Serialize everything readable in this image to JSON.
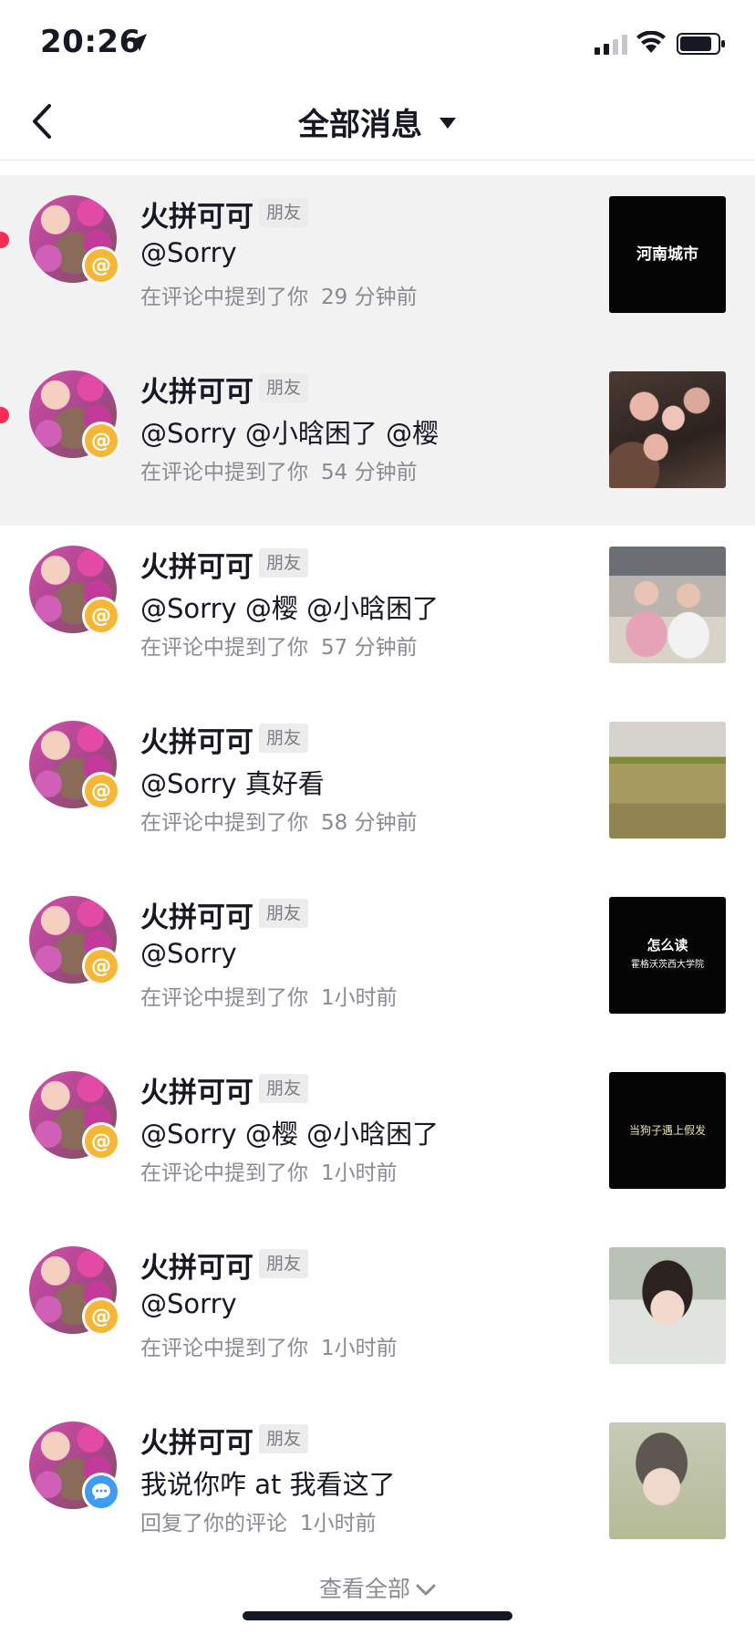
{
  "status": {
    "time": "20:26"
  },
  "nav": {
    "title": "全部消息"
  },
  "rows": [
    {
      "name": "火拼可可",
      "tag": "朋友",
      "message": "@Sorry",
      "action": "在评论中提到了你",
      "time": "29 分钟前",
      "thumb_text": "河南城市"
    },
    {
      "name": "火拼可可",
      "tag": "朋友",
      "message": "@Sorry @小晗困了 @樱",
      "action": "在评论中提到了你",
      "time": "54 分钟前"
    },
    {
      "name": "火拼可可",
      "tag": "朋友",
      "message": "@Sorry @樱 @小晗困了",
      "action": "在评论中提到了你",
      "time": "57 分钟前"
    },
    {
      "name": "火拼可可",
      "tag": "朋友",
      "message": "@Sorry 真好看",
      "action": "在评论中提到了你",
      "time": "58 分钟前"
    },
    {
      "name": "火拼可可",
      "tag": "朋友",
      "message": "@Sorry",
      "action": "在评论中提到了你",
      "time": "1小时前",
      "thumb_text": "怎么读",
      "thumb_subtext": "霍格沃茨西大学院"
    },
    {
      "name": "火拼可可",
      "tag": "朋友",
      "message": "@Sorry @樱 @小晗困了",
      "action": "在评论中提到了你",
      "time": "1小时前",
      "thumb_text": "当狗子遇上假发"
    },
    {
      "name": "火拼可可",
      "tag": "朋友",
      "message": "@Sorry",
      "action": "在评论中提到了你",
      "time": "1小时前"
    },
    {
      "name": "火拼可可",
      "tag": "朋友",
      "message": "我说你咋 at 我看这了",
      "action": "回复了你的评论",
      "time": "1小时前"
    }
  ],
  "footer": {
    "view_all": "查看全部"
  },
  "colors": {
    "accent_red": "#fe2c55",
    "mention_badge": "#f6b636",
    "reply_badge": "#3f9cf6"
  },
  "icons": [
    "location-arrow-icon",
    "signal-icon",
    "wifi-icon",
    "battery-icon",
    "back-icon",
    "caret-down-icon",
    "at-icon",
    "comment-icon",
    "chevron-down-icon"
  ]
}
